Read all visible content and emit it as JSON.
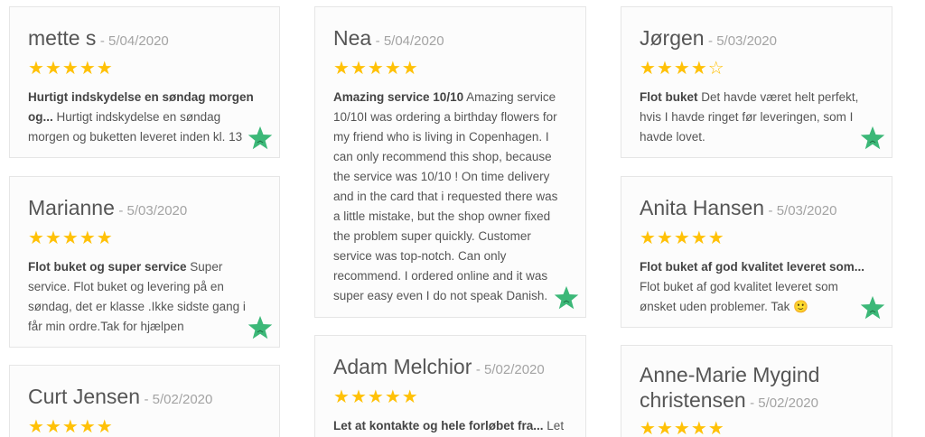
{
  "reviews": [
    {
      "name": "mette s",
      "date": "- 5/04/2020",
      "rating": 5,
      "title": "Hurtigt indskydelse en søndag morgen og...",
      "body": " Hurtigt indskydelse en søndag morgen og buketten leveret inden kl. 13"
    },
    {
      "name": "Nea",
      "date": "- 5/04/2020",
      "rating": 5,
      "title": "Amazing service 10/10",
      "body": " Amazing service 10/10I was ordering a birthday flowers for my friend who is living in Copenhagen. I can only recommend this shop, because the service was 10/10 ! On time delivery and in the card that i requested there was a little mistake, but the shop owner fixed the problem super quickly. Customer service was top-notch. Can only recommend. I ordered online and it was super easy even I do not speak Danish."
    },
    {
      "name": "Jørgen",
      "date": "- 5/03/2020",
      "rating": 4,
      "title": "Flot buket",
      "body": " Det havde været helt perfekt, hvis I havde ringet før leveringen, som I havde lovet."
    },
    {
      "name": "Marianne",
      "date": "- 5/03/2020",
      "rating": 5,
      "title": "Flot buket og super service",
      "body": " Super service. Flot buket og levering på en søndag, det er klasse .Ikke sidste gang i får min ordre.Tak for hjælpen"
    },
    {
      "name": "Anita Hansen",
      "date": "- 5/03/2020",
      "rating": 5,
      "title": "Flot buket af god kvalitet leveret som...",
      "body": " Flot buket af god kvalitet leveret som ønsket uden problemer. Tak 🙂"
    },
    {
      "name": "Curt Jensen",
      "date": "- 5/02/2020",
      "rating": 5,
      "title": "",
      "body": ""
    },
    {
      "name": "Adam Melchior",
      "date": "- 5/02/2020",
      "rating": 5,
      "title": "Let at kontakte og hele forløbet fra...",
      "body": " Let"
    },
    {
      "name": "Anne-Marie Mygind christensen",
      "date": "- 5/02/2020",
      "rating": 5,
      "title": "",
      "body": ""
    }
  ],
  "colors": {
    "star": "#ffc107",
    "badge": "#3cb878"
  },
  "icons": {
    "star": "star-icon",
    "badge": "trustpilot-star-icon"
  }
}
